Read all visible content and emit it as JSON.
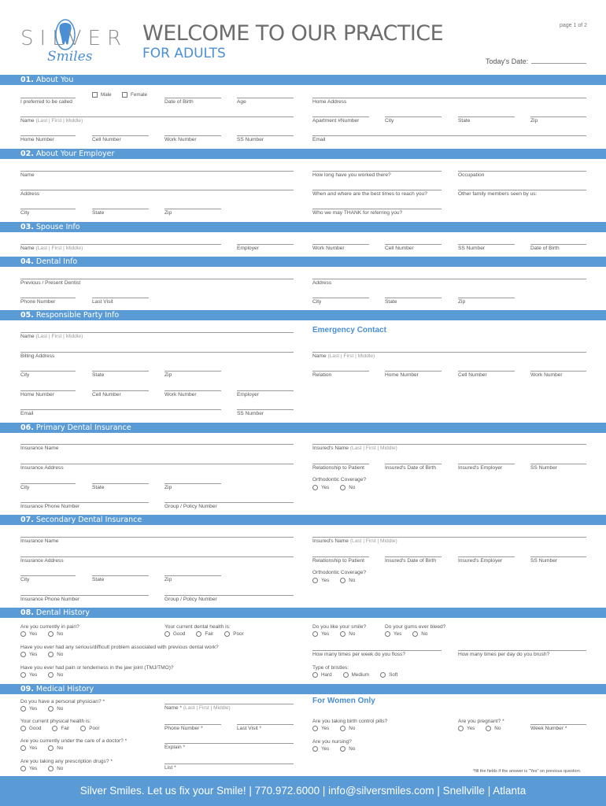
{
  "header": {
    "logo_text_top": "SILVER",
    "logo_text_bottom": "Smiles",
    "title": "WELCOME TO OUR PRACTICE",
    "subtitle": "FOR ADULTS",
    "page": "page 1 of 2",
    "todays_date_label": "Today's Date:"
  },
  "s1": {
    "title_num": "01.",
    "title": "About You",
    "male": "Male",
    "female": "Female",
    "preferred": "I preferred to be called",
    "dob": "Date of Birth",
    "age": "Age",
    "home_address": "Home Address",
    "name_main": "Name",
    "name_sub": "(Last | First | Middle)",
    "apt": "Apartment #Number",
    "city": "City",
    "state": "State",
    "zip": "Zip",
    "home_number": "Home Number",
    "cell_number": "Cell Number",
    "work_number": "Work Number",
    "ss_number": "SS Number",
    "email": "Email"
  },
  "s2": {
    "title_num": "02.",
    "title": "About Your Employer",
    "name": "Name",
    "how_long": "How long have you worked there?",
    "occupation": "Occupation",
    "address": "Address",
    "best_times": "When and where are the best times to reach you?",
    "family": "Other family members seen by us:",
    "city": "City",
    "state": "State",
    "zip": "Zip",
    "thank": "Who we may THANK for referring you?"
  },
  "s3": {
    "title_num": "03.",
    "title": "Spouse Info",
    "name_main": "Name",
    "name_sub": "(Last | First | Middle)",
    "employer": "Employer",
    "work_number": "Work Number",
    "cell_number": "Cell Number",
    "ss_number": "SS Number",
    "dob": "Date of Birth"
  },
  "s4": {
    "title_num": "04.",
    "title": "Dental Info",
    "prev_dentist": "Previous / Present Dentist",
    "address": "Address",
    "phone": "Phone Number",
    "last_visit": "Last Visit",
    "city": "City",
    "state": "State",
    "zip": "Zip"
  },
  "s5": {
    "title_num": "05.",
    "title": "Responsible Party Info",
    "name_main": "Name",
    "name_sub": "(Last | First | Middle)",
    "emergency": "Emergency Contact",
    "billing": "Billing Address",
    "em_name_main": "Name",
    "em_name_sub": "(Last | First | Middle)",
    "city": "City",
    "state": "State",
    "zip": "Zip",
    "relation": "Relation",
    "home_number": "Home Number",
    "cell_number": "Cell Number",
    "work_number": "Work Number",
    "home_number2": "Home Number",
    "cell_number2": "Cell Number",
    "work_number2": "Work Number",
    "employer": "Employer",
    "email": "Email",
    "ss_number": "SS Number"
  },
  "s6": {
    "title_num": "06.",
    "title": "Primary Dental Insurance",
    "ins_name": "Insurance Name",
    "insured_name_main": "Insured's Name",
    "insured_name_sub": "(Last | First | Middle)",
    "ins_address": "Insurance Address",
    "relationship": "Relationship to Patient",
    "insured_dob": "Insured's Date of Birth",
    "insured_employer": "Insured's Employer",
    "ss_number": "SS Number",
    "ortho": "Orthodontic Coverage?",
    "yes": "Yes",
    "no": "No",
    "city": "City",
    "state": "State",
    "zip": "Zip",
    "ins_phone": "Insurance Phone Number",
    "group": "Group / Policy Number"
  },
  "s7": {
    "title_num": "07.",
    "title": "Secondary Dental Insurance",
    "ins_name": "Insurance Name",
    "insured_name_main": "Insured's Name",
    "insured_name_sub": "(Last | First | Middle)",
    "ins_address": "Insurance Address",
    "relationship": "Relationship to Patient",
    "insured_dob": "Insured's Date of Birth",
    "insured_employer": "Insured's Employer",
    "ss_number": "SS Number",
    "ortho": "Orthodontic Coverage?",
    "yes": "Yes",
    "no": "No",
    "city": "City",
    "state": "State",
    "zip": "Zip",
    "ins_phone": "Insurance Phone Number",
    "group": "Group / Policy Number"
  },
  "s8": {
    "title_num": "08.",
    "title": "Dental History",
    "pain_q": "Are you currently in pain?",
    "health_q": "Your current dental health is:",
    "good": "Good",
    "fair": "Fair",
    "poor": "Poor",
    "smile_q": "Do you like your smile?",
    "gums_q": "Do your gums ever bleed?",
    "yes": "Yes",
    "no": "No",
    "serious_q": "Have you ever had any serious/difficult problem associated with previous dental work?",
    "floss_q": "How many times per week do you floss?",
    "brush_q": "How many times per day do you brush?",
    "tmj_q": "Have you ever had pain or tenderness in the jaw joint (TMJ/TMO)?",
    "bristles_q": "Type of bristles:",
    "hard": "Hard",
    "medium": "Medium",
    "soft": "Soft"
  },
  "s9": {
    "title_num": "09.",
    "title": "Medical History",
    "physician_q": "Do you have a personal physician? *",
    "name_main": "Name *",
    "name_sub": "(Last | First | Middle)",
    "women_only": "For Women Only",
    "phys_health_q": "Your current physical health is:",
    "good": "Good",
    "fair": "Fair",
    "poor": "Poor",
    "phone": "Phone Number *",
    "last_visit": "Last Visit *",
    "bc_q": "Are you taking birth control pills?",
    "pregnant_q": "Are you pregnant? *",
    "week": "Week Number *",
    "doctor_q": "Are you currently under the care of a doctor? *",
    "explain": "Explain *",
    "nursing_q": "Are you nursing?",
    "rx_q": "Are you taking any prescription drugs? *",
    "list": "List *",
    "note": "*fill the fields if the answer is \"Yes\" on previous question.",
    "yes": "Yes",
    "no": "No"
  },
  "footer": "Silver Smiles.  Let us fix your Smile! | 770.972.6000 | info@silversmiles.com | Snellville | Atlanta"
}
